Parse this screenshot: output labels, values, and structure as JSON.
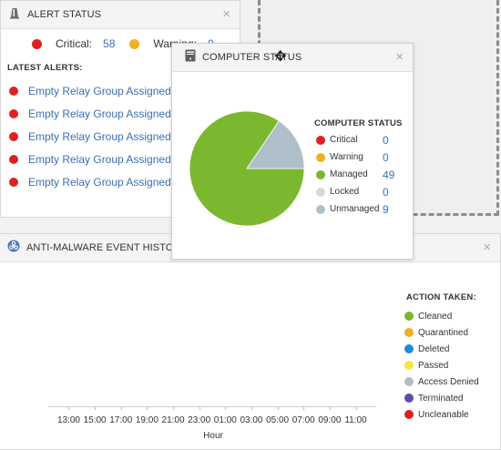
{
  "alert_status": {
    "title": "ALERT STATUS",
    "close": "×",
    "counts": [
      {
        "label": "Critical:",
        "value": "58",
        "color": "#e02020"
      },
      {
        "label": "Warning:",
        "value": "0",
        "color": "#f0b020"
      }
    ],
    "latest_label": "LATEST ALERTS:",
    "alerts": [
      {
        "text": "Empty Relay Group Assigned -",
        "color": "#e02020"
      },
      {
        "text": "Empty Relay Group Assigned -",
        "color": "#e02020"
      },
      {
        "text": "Empty Relay Group Assigned -",
        "color": "#e02020"
      },
      {
        "text": "Empty Relay Group Assigned -",
        "color": "#e02020"
      },
      {
        "text": "Empty Relay Group Assigned -",
        "color": "#e02020"
      }
    ]
  },
  "computer_status": {
    "title": "COMPUTER STATUS",
    "close": "×",
    "move_icon": "✥",
    "legend_title": "COMPUTER STATUS",
    "items": [
      {
        "label": "Critical",
        "value": "0",
        "color": "#e02020"
      },
      {
        "label": "Warning",
        "value": "0",
        "color": "#f0b020"
      },
      {
        "label": "Managed",
        "value": "49",
        "color": "#7cb82f"
      },
      {
        "label": "Locked",
        "value": "0",
        "color": "#d9d9d9"
      },
      {
        "label": "Unmanaged",
        "value": "9",
        "color": "#aebfc9"
      }
    ]
  },
  "anti_malware": {
    "title": "ANTI-MALWARE EVENT HISTORY",
    "close": "×",
    "x_ticks": [
      "13:00",
      "15:00",
      "17:00",
      "19:00",
      "21:00",
      "23:00",
      "01:00",
      "03:00",
      "05:00",
      "07:00",
      "09:00",
      "11:00"
    ],
    "x_label": "Hour",
    "legend_title": "ACTION TAKEN:",
    "legend": [
      {
        "label": "Cleaned",
        "color": "#7cb82f"
      },
      {
        "label": "Quarantined",
        "color": "#f0b020"
      },
      {
        "label": "Deleted",
        "color": "#1a8fd6"
      },
      {
        "label": "Passed",
        "color": "#f5e642"
      },
      {
        "label": "Access Denied",
        "color": "#aebfc9"
      },
      {
        "label": "Terminated",
        "color": "#5a4fa8"
      },
      {
        "label": "Uncleanable",
        "color": "#e02020"
      }
    ]
  }
}
